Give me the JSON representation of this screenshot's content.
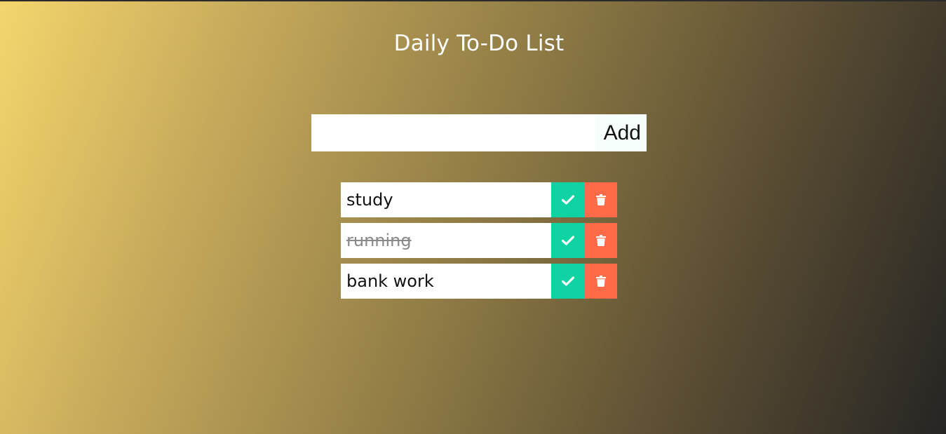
{
  "header": {
    "title": "Daily To-Do List"
  },
  "form": {
    "input_value": "",
    "add_label": "Add"
  },
  "todos": [
    {
      "text": "study",
      "completed": false
    },
    {
      "text": "running",
      "completed": true
    },
    {
      "text": "bank work",
      "completed": false
    }
  ],
  "icons": {
    "complete": "check-icon",
    "delete": "trash-icon"
  },
  "colors": {
    "complete_button": "#0fd3a3",
    "delete_button": "#ff6b48",
    "gradient_start": "#f5d56c",
    "gradient_end": "#262523"
  }
}
